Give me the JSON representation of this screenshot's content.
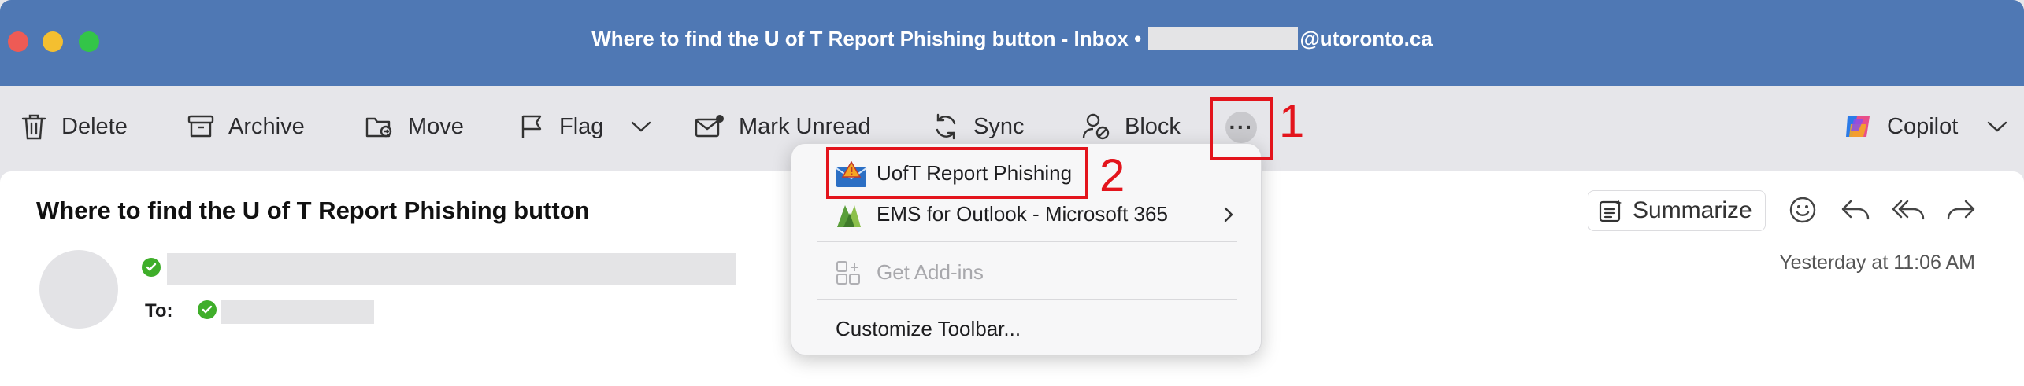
{
  "window": {
    "title_prefix": "Where to find the U of T Report Phishing button - Inbox •",
    "title_suffix": "@utoronto.ca"
  },
  "toolbar": {
    "delete": "Delete",
    "archive": "Archive",
    "move": "Move",
    "flag": "Flag",
    "mark_unread": "Mark Unread",
    "sync": "Sync",
    "block": "Block",
    "more": "···",
    "copilot": "Copilot"
  },
  "menu": {
    "items": [
      {
        "label": "UofT Report Phishing",
        "icon": "report-phishing-icon"
      },
      {
        "label": "EMS for Outlook - Microsoft 365",
        "icon": "ems-icon"
      },
      {
        "label": "Get Add-ins",
        "icon": "add-ins-icon"
      },
      {
        "label": "Customize Toolbar..."
      }
    ]
  },
  "annotations": {
    "one": "1",
    "two": "2"
  },
  "message": {
    "subject": "Where to find the U of T Report Phishing button",
    "to_label": "To:",
    "timestamp": "Yesterday at 11:06 AM",
    "summarize": "Summarize"
  },
  "colors": {
    "titlebar": "#4f78b4",
    "annotation": "#e3141c",
    "verified": "#3fae2a"
  }
}
